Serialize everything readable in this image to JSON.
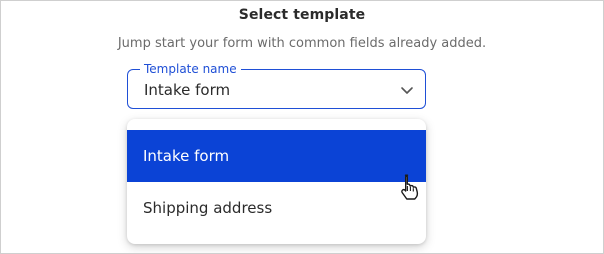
{
  "dialog": {
    "title": "Select template",
    "subtitle": "Jump start your form with common fields already added."
  },
  "template_select": {
    "label": "Template name",
    "value": "Intake form",
    "options": [
      {
        "label": "Intake form",
        "selected": true
      },
      {
        "label": "Shipping address",
        "selected": false
      }
    ]
  },
  "colors": {
    "accent": "#1f4fd6",
    "selected_bg": "#0b43d6"
  },
  "icons": {
    "dropdown": "chevron-down-icon",
    "cursor": "hand-pointer-icon"
  }
}
